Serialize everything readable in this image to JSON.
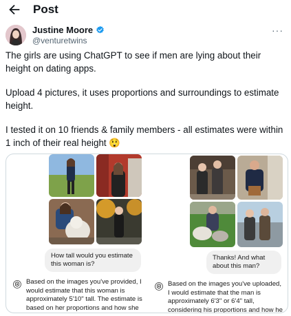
{
  "header": {
    "title": "Post",
    "back_icon": "arrow-left-icon"
  },
  "author": {
    "name": "Justine Moore",
    "handle": "@venturetwins",
    "verified_icon": "verified-badge-icon",
    "verified_color": "#1d9bf0",
    "more_icon": "more-horizontal-icon",
    "more_label": "···"
  },
  "tweet": {
    "paragraphs": [
      "The girls are using ChatGPT to see if men are lying about their height on dating apps.",
      "Upload 4 pictures, it uses proportions and surroundings to estimate height.",
      "I tested it on 10 friends & family members - all estimates were within 1 inch of their real height 😲"
    ]
  },
  "media": {
    "left": {
      "question": "How tall would you estimate this woman is?",
      "answer": "Based on the images you've provided, I would estimate that this woman is approximately 5'10\" tall. The estimate is based on her proportions and how she"
    },
    "right": {
      "question": "Thanks! And what about this man?",
      "answer": "Based on the images you've uploaded, I would estimate that the man is approximately 6'3\" or 6'4\" tall, considering his proportions and how he"
    }
  }
}
